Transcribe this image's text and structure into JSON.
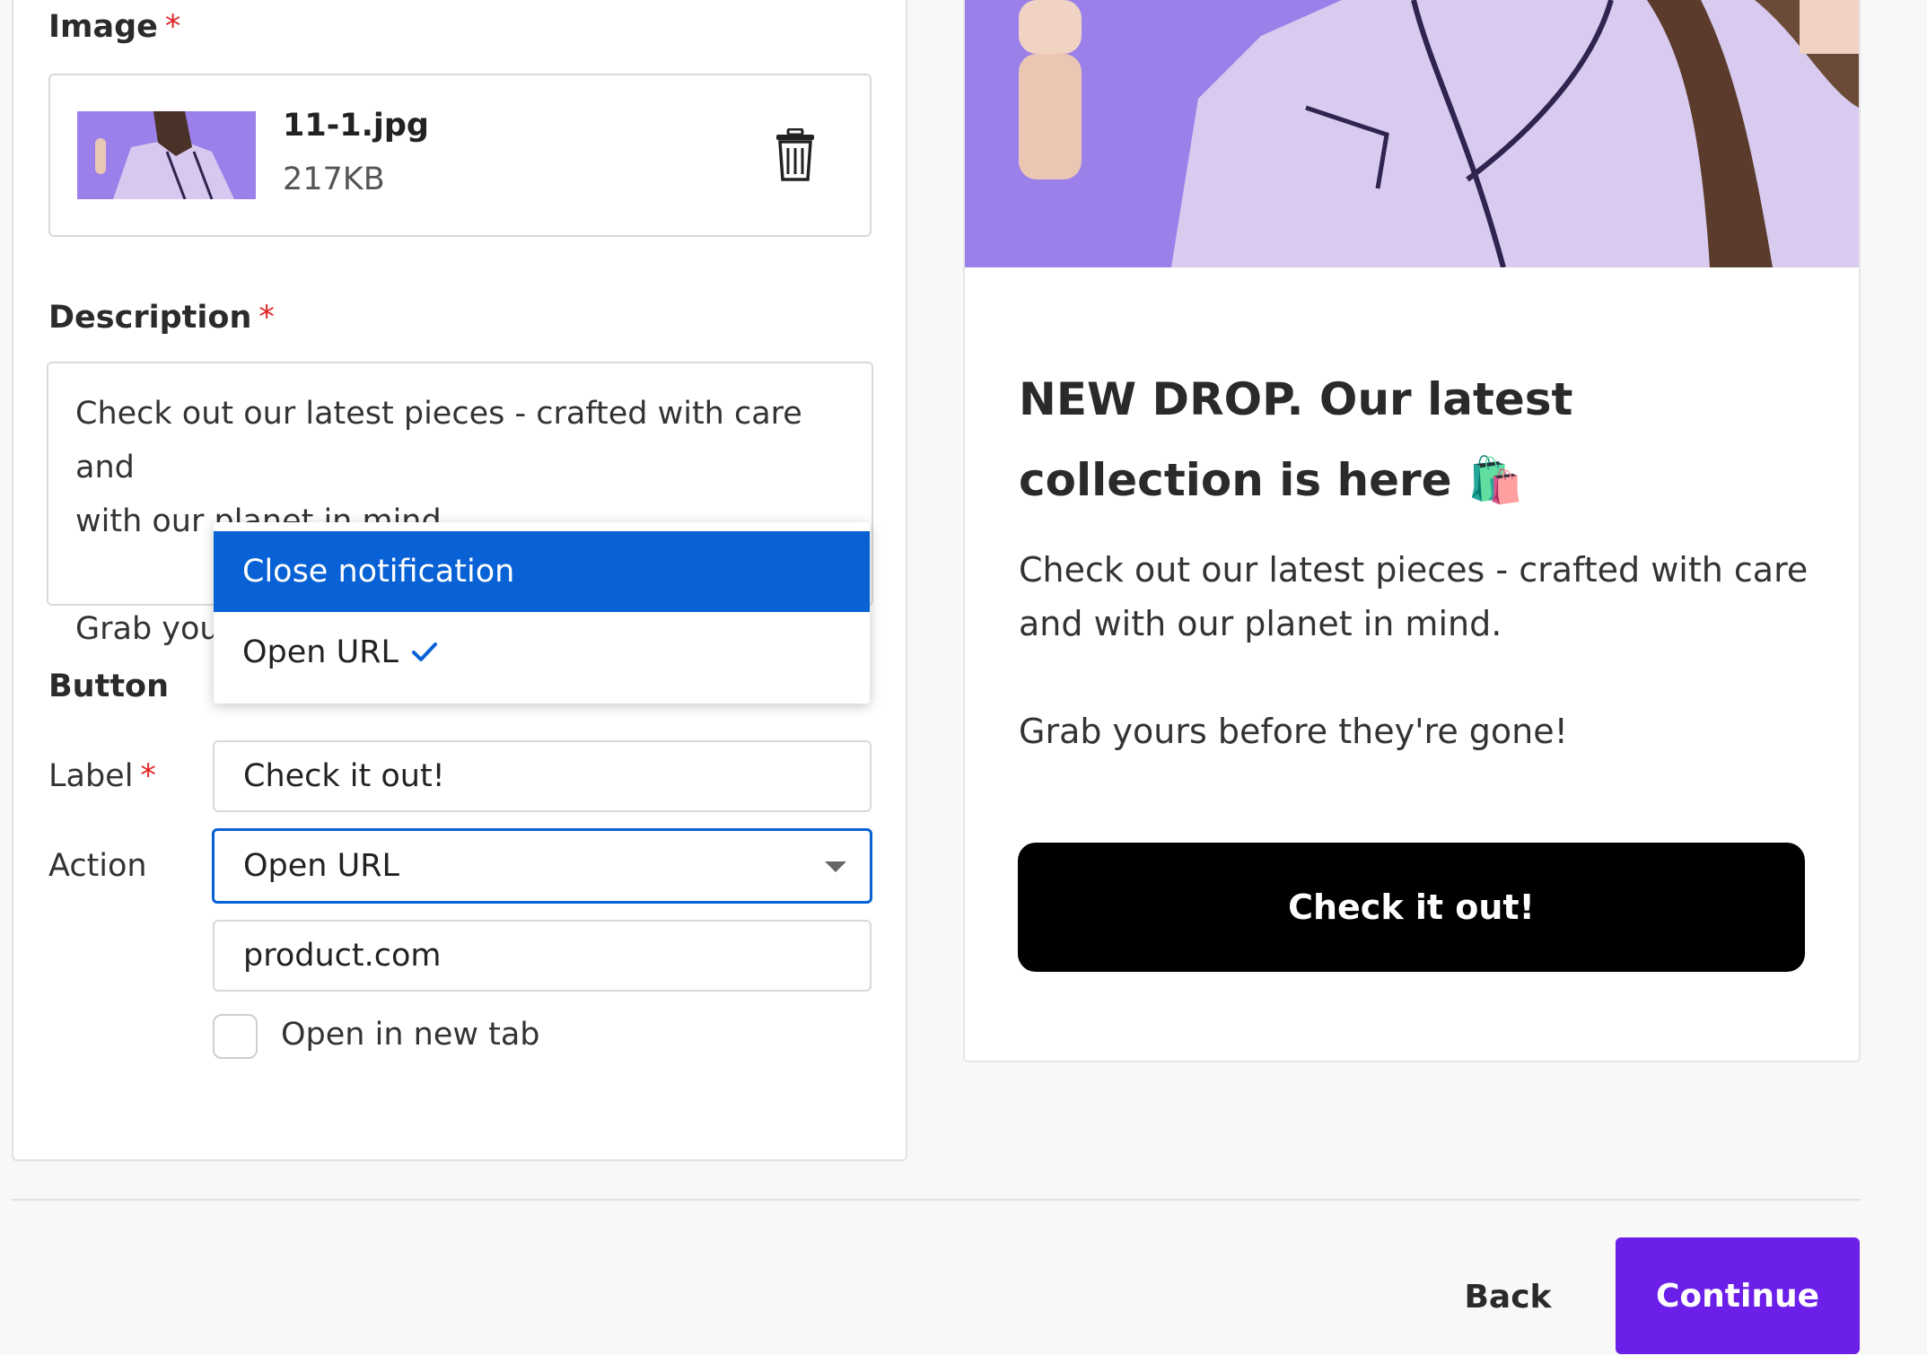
{
  "form": {
    "image_label": "Image",
    "required_mark": "*",
    "file": {
      "name": "11-1.jpg",
      "size": "217KB"
    },
    "description_label": "Description",
    "description_line1": "Check out our latest pieces - crafted with care and",
    "description_line2": "with our planet in mind.",
    "description_line3": "Grab your",
    "button_section_label": "Button",
    "label_field_label": "Label",
    "label_value": "Check it out!",
    "action_field_label": "Action",
    "action_value": "Open URL",
    "url_value": "product.com",
    "open_new_tab_label": "Open in new tab"
  },
  "dropdown": {
    "options": [
      {
        "label": "Close notification",
        "highlighted": true
      },
      {
        "label": "Open URL",
        "selected": true
      }
    ]
  },
  "preview": {
    "title": "NEW DROP. Our latest collection is here 🛍️",
    "body_line1": "Check out our latest pieces - crafted with care and with our planet in mind.",
    "body_line2": "Grab yours before they're gone!",
    "button_label": "Check it out!"
  },
  "footer": {
    "back_label": "Back",
    "continue_label": "Continue"
  },
  "colors": {
    "primary": "#6b1fe8",
    "focus_blue": "#0862d5",
    "required": "#e02424",
    "hero_bg": "#9b80ea"
  },
  "icons": {
    "trash": "trash-icon",
    "check": "check-icon",
    "caret": "chevron-down-icon"
  }
}
